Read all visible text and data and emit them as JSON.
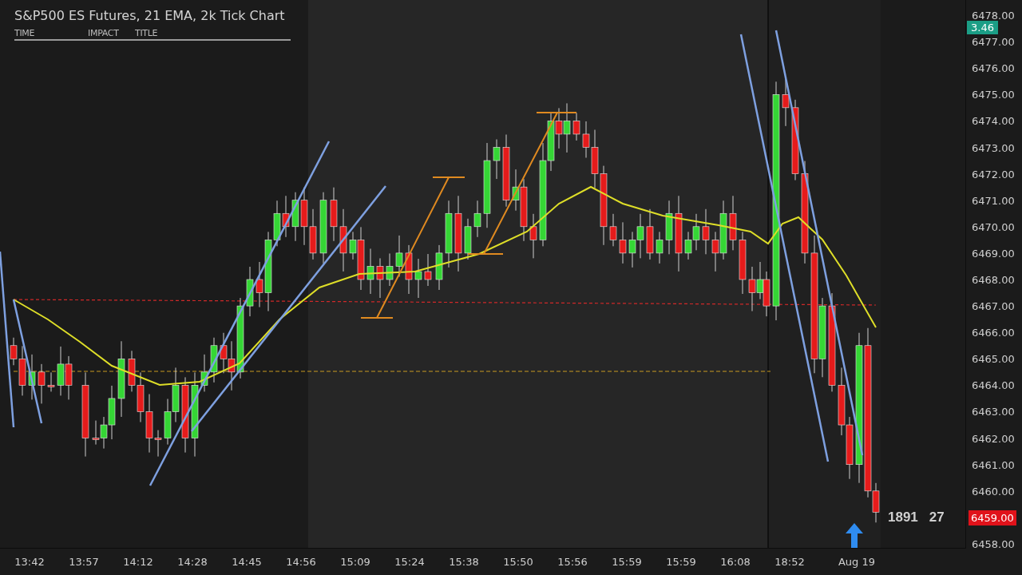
{
  "chart": {
    "title": "S&P500 ES Futures, 21 EMA, 2k Tick Chart",
    "news_columns": [
      "TIME",
      "IMPACT",
      "TITLE"
    ],
    "bar_stats": [
      "1891",
      "27"
    ]
  },
  "price_axis": {
    "badge": "3.46",
    "labels": [
      {
        "text": "6478.00",
        "kind": "plain"
      },
      {
        "text": "6477.00",
        "kind": "plain"
      },
      {
        "text": "6476.00",
        "kind": "plain"
      },
      {
        "text": "6475.00",
        "kind": "plain"
      },
      {
        "text": "6474.00",
        "kind": "plain"
      },
      {
        "text": "6473.00",
        "kind": "plain"
      },
      {
        "text": "6472.00",
        "kind": "plain"
      },
      {
        "text": "6471.00",
        "kind": "plain"
      },
      {
        "text": "6470.00",
        "kind": "plain"
      },
      {
        "text": "6469.00",
        "kind": "plain"
      },
      {
        "text": "6468.00",
        "kind": "plain"
      },
      {
        "text": "6467.00",
        "kind": "plain"
      },
      {
        "text": "6466.00",
        "kind": "plain"
      },
      {
        "text": "6465.00",
        "kind": "plain"
      },
      {
        "text": "6464.00",
        "kind": "plain"
      },
      {
        "text": "6463.00",
        "kind": "plain"
      },
      {
        "text": "6462.00",
        "kind": "plain"
      },
      {
        "text": "6461.00",
        "kind": "plain"
      },
      {
        "text": "6460.00",
        "kind": "plain"
      },
      {
        "text": "6459.00",
        "kind": "current"
      },
      {
        "text": "6458.00",
        "kind": "plain"
      }
    ]
  },
  "time_axis": [
    "13:42",
    "13:57",
    "14:12",
    "14:28",
    "14:45",
    "14:56",
    "15:09",
    "15:24",
    "15:38",
    "15:50",
    "15:56",
    "15:59",
    "15:59",
    "16:08",
    "18:52",
    "Aug 19"
  ]
}
